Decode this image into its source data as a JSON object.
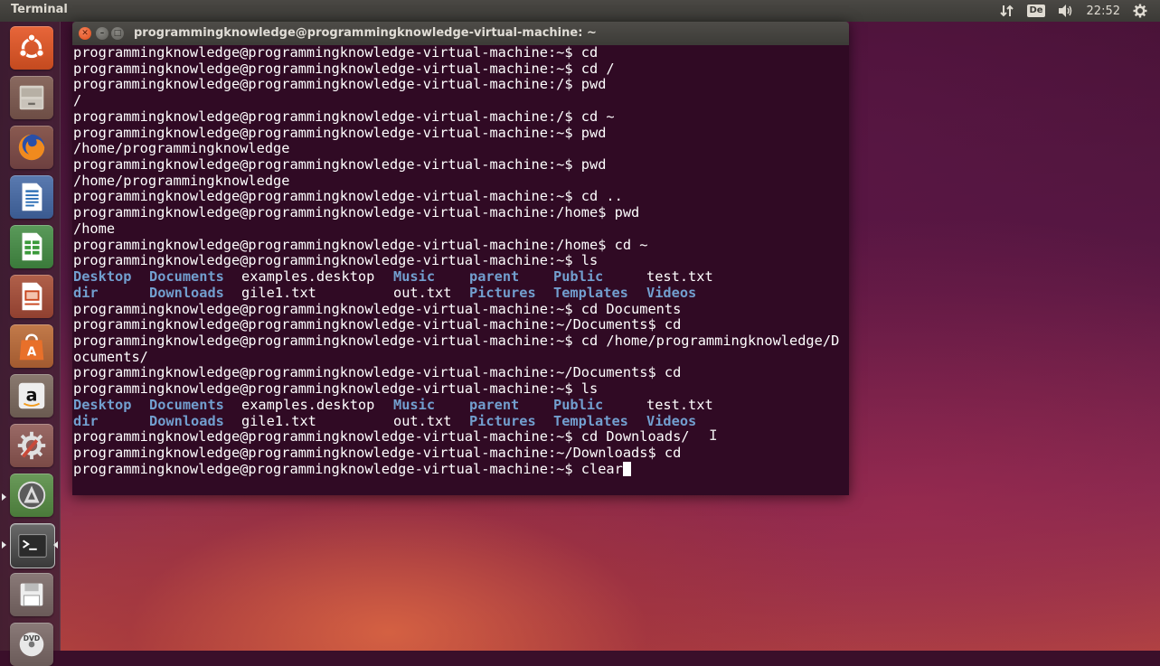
{
  "top_panel": {
    "app_title": "Terminal",
    "keyboard_layout": "De",
    "time": "22:52",
    "icons": [
      "network-transfer-icon",
      "keyboard-layout-icon",
      "volume-icon",
      "settings-gear-icon"
    ]
  },
  "launcher": {
    "items": [
      {
        "name": "ubuntu-dash",
        "icon": "ubuntu-logo-icon"
      },
      {
        "name": "files",
        "icon": "file-cabinet-icon"
      },
      {
        "name": "firefox",
        "icon": "firefox-icon"
      },
      {
        "name": "writer",
        "icon": "libreoffice-writer-icon"
      },
      {
        "name": "calc",
        "icon": "libreoffice-calc-icon"
      },
      {
        "name": "impress",
        "icon": "libreoffice-impress-icon"
      },
      {
        "name": "software-center",
        "icon": "shopping-bag-icon"
      },
      {
        "name": "amazon",
        "icon": "amazon-icon"
      },
      {
        "name": "system-settings",
        "icon": "gear-wrench-icon"
      },
      {
        "name": "software-updater",
        "icon": "updater-icon"
      },
      {
        "name": "terminal",
        "icon": "terminal-icon"
      },
      {
        "name": "floppy-drive",
        "icon": "floppy-disk-icon"
      },
      {
        "name": "dvd-drive",
        "icon": "dvd-icon"
      }
    ],
    "colors": {
      "ubuntu": "#e05a2a",
      "files": "#c9c3ba",
      "firefox": "#e66000",
      "writer": "#2a6db5",
      "calc": "#3a9a3a",
      "impress": "#c8451e",
      "software_center": "#e8702a",
      "amazon": "#eeeeee",
      "settings": "#c94a3a",
      "updater": "#5a8a3a",
      "terminal": "#2b2b2b"
    }
  },
  "terminal": {
    "window_title": "programmingknowledge@programmingknowledge-virtual-machine: ~",
    "background_color": "#300a24",
    "text_color": "#ffffff",
    "dir_color": "#729fcf",
    "lines_before_ls1": [
      "programmingknowledge@programmingknowledge-virtual-machine:~$ cd",
      "programmingknowledge@programmingknowledge-virtual-machine:~$ cd /",
      "programmingknowledge@programmingknowledge-virtual-machine:/$ pwd",
      "/",
      "programmingknowledge@programmingknowledge-virtual-machine:/$ cd ~",
      "programmingknowledge@programmingknowledge-virtual-machine:~$ pwd",
      "/home/programmingknowledge",
      "programmingknowledge@programmingknowledge-virtual-machine:~$ pwd",
      "/home/programmingknowledge",
      "programmingknowledge@programmingknowledge-virtual-machine:~$ cd ..",
      "programmingknowledge@programmingknowledge-virtual-machine:/home$ pwd",
      "/home",
      "programmingknowledge@programmingknowledge-virtual-machine:/home$ cd ~",
      "programmingknowledge@programmingknowledge-virtual-machine:~$ ls"
    ],
    "ls_output_1": [
      [
        {
          "text": "Desktop",
          "type": "dir"
        },
        {
          "text": "Documents",
          "type": "dir"
        },
        {
          "text": "examples.desktop",
          "type": "file"
        },
        {
          "text": "Music",
          "type": "dir"
        },
        {
          "text": "parent",
          "type": "dir"
        },
        {
          "text": "Public",
          "type": "dir"
        },
        {
          "text": "test.txt",
          "type": "file"
        }
      ],
      [
        {
          "text": "dir",
          "type": "dir"
        },
        {
          "text": "Downloads",
          "type": "dir"
        },
        {
          "text": "gile1.txt",
          "type": "file"
        },
        {
          "text": "out.txt",
          "type": "file"
        },
        {
          "text": "Pictures",
          "type": "dir"
        },
        {
          "text": "Templates",
          "type": "dir"
        },
        {
          "text": "Videos",
          "type": "dir"
        }
      ]
    ],
    "lines_between": [
      "programmingknowledge@programmingknowledge-virtual-machine:~$ cd Documents",
      "programmingknowledge@programmingknowledge-virtual-machine:~/Documents$ cd",
      "programmingknowledge@programmingknowledge-virtual-machine:~$ cd /home/programmingknowledge/D",
      "ocuments/",
      "programmingknowledge@programmingknowledge-virtual-machine:~/Documents$ cd",
      "programmingknowledge@programmingknowledge-virtual-machine:~$ ls"
    ],
    "ls_output_2": [
      [
        {
          "text": "Desktop",
          "type": "dir"
        },
        {
          "text": "Documents",
          "type": "dir"
        },
        {
          "text": "examples.desktop",
          "type": "file"
        },
        {
          "text": "Music",
          "type": "dir"
        },
        {
          "text": "parent",
          "type": "dir"
        },
        {
          "text": "Public",
          "type": "dir"
        },
        {
          "text": "test.txt",
          "type": "file"
        }
      ],
      [
        {
          "text": "dir",
          "type": "dir"
        },
        {
          "text": "Downloads",
          "type": "dir"
        },
        {
          "text": "gile1.txt",
          "type": "file"
        },
        {
          "text": "out.txt",
          "type": "file"
        },
        {
          "text": "Pictures",
          "type": "dir"
        },
        {
          "text": "Templates",
          "type": "dir"
        },
        {
          "text": "Videos",
          "type": "dir"
        }
      ]
    ],
    "lines_after": [
      "programmingknowledge@programmingknowledge-virtual-machine:~$ cd Downloads/",
      "programmingknowledge@programmingknowledge-virtual-machine:~/Downloads$ cd"
    ],
    "current_prompt": "programmingknowledge@programmingknowledge-virtual-machine:~$ ",
    "current_input": "clear"
  }
}
